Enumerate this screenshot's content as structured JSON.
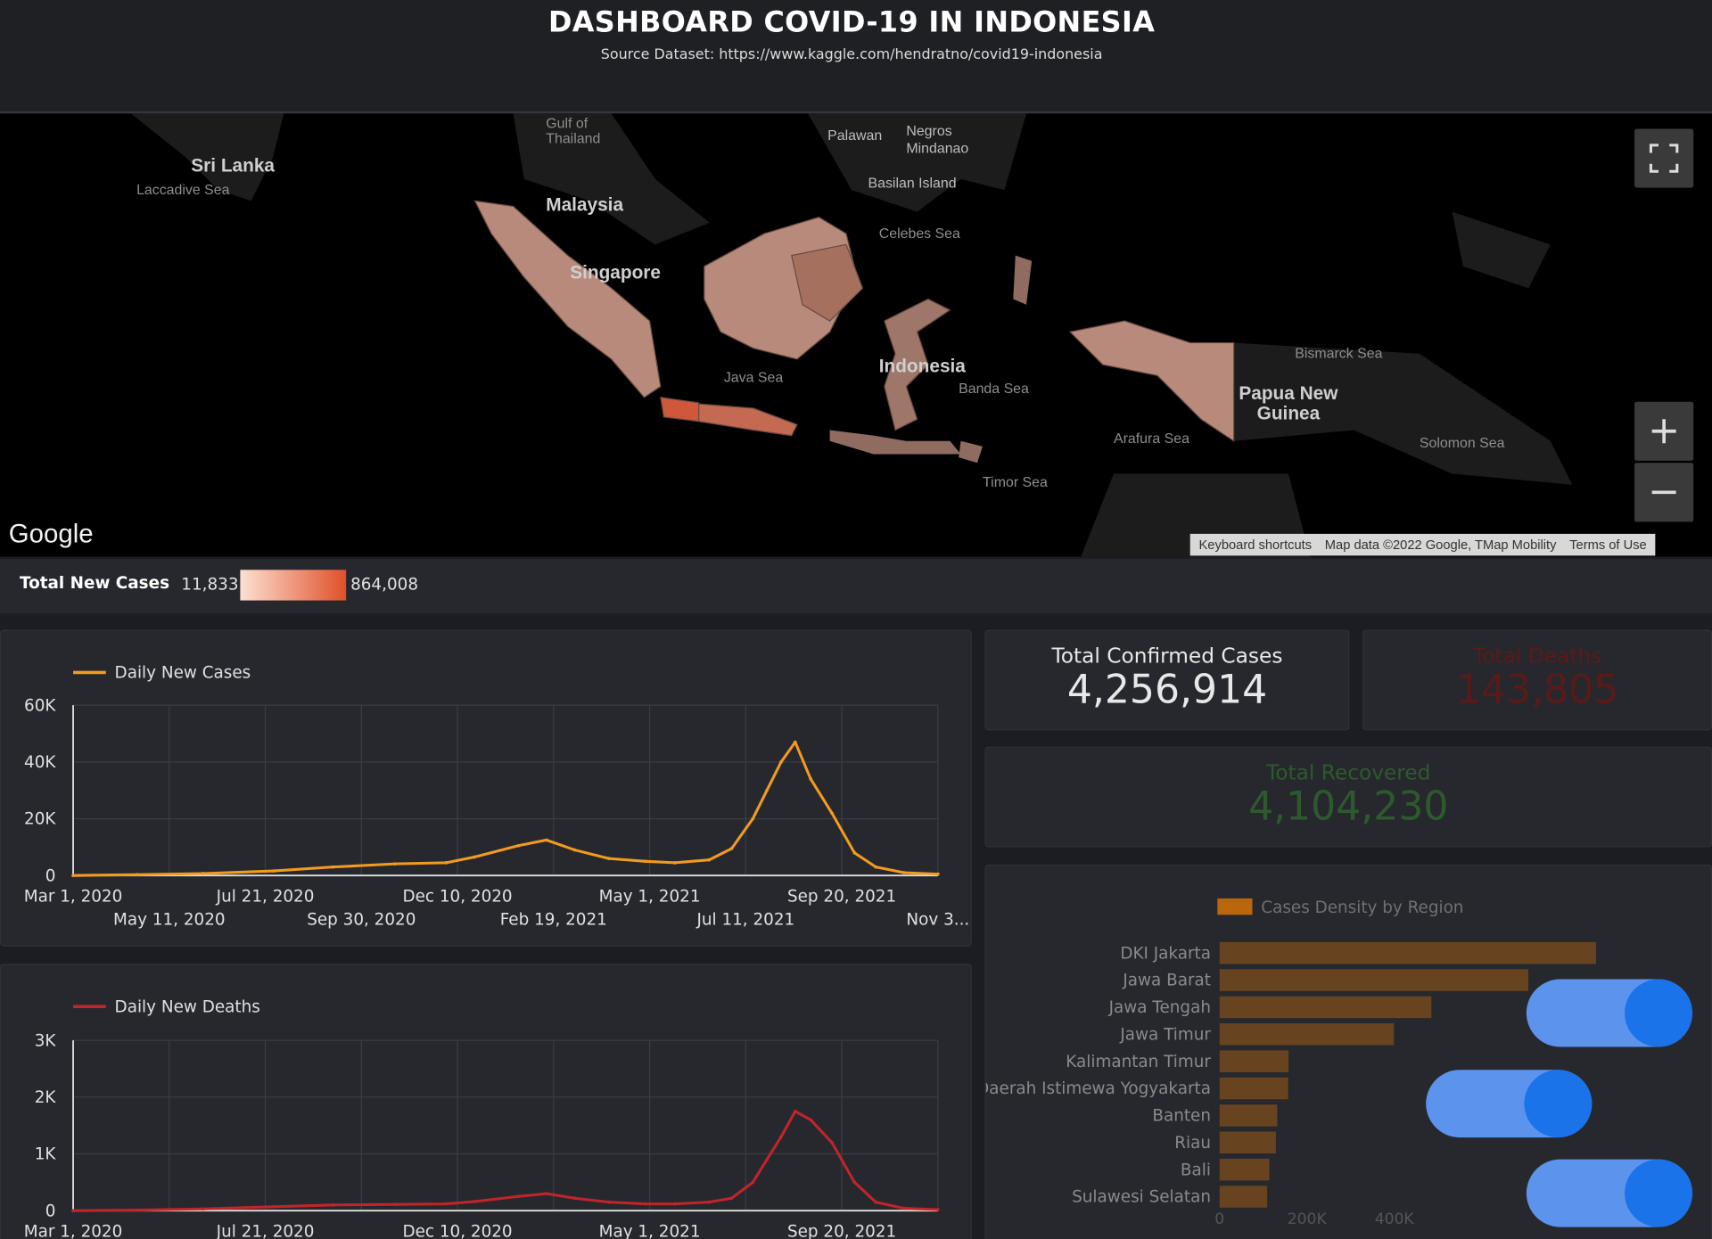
{
  "header": {
    "title": "DASHBOARD COVID-19 IN INDONESIA",
    "subtitle": "Source Dataset: https://www.kaggle.com/hendratno/covid19-indonesia"
  },
  "map": {
    "labels": {
      "sri_lanka": "Sri Lanka",
      "laccadive_sea": "Laccadive Sea",
      "gulf_of_thailand": "Gulf of Thailand",
      "palawan": "Palawan",
      "negros_mindanao": "Negros Mindanao",
      "basilan_island": "Basilan Island",
      "malaysia": "Malaysia",
      "celebes_sea": "Celebes Sea",
      "singapore": "Singapore",
      "java_sea": "Java Sea",
      "indonesia": "Indonesia",
      "banda_sea": "Banda Sea",
      "bismarck_sea": "Bismarck Sea",
      "papua_new_guinea": "Papua New Guinea",
      "arafura_sea": "Arafura Sea",
      "solomon_sea": "Solomon Sea",
      "timor_sea": "Timor Sea"
    },
    "google_logo": "Google",
    "footer": {
      "keyboard_shortcuts": "Keyboard shortcuts",
      "map_data": "Map data ©2022 Google, TMap Mobility",
      "terms": "Terms of Use"
    },
    "icons": {
      "fullscreen": "fullscreen-icon",
      "zoom_in": "plus-icon",
      "zoom_out": "minus-icon"
    },
    "legend": {
      "label": "Total New Cases",
      "min": "11,833",
      "max": "864,008",
      "color_low": "#fde0d2",
      "color_high": "#e0502a"
    }
  },
  "kpis": {
    "confirmed": {
      "label": "Total Confirmed Cases",
      "value": "4,256,914",
      "color": "#e8e8e8"
    },
    "deaths": {
      "label": "Total Deaths",
      "value": "143,805",
      "color": "#5a1a1a"
    },
    "recovered": {
      "label": "Total Recovered",
      "value": "4,104,230",
      "color": "#2d5a2d"
    }
  },
  "chart_data": [
    {
      "type": "line",
      "series": [
        {
          "name": "Daily New Cases",
          "color": "#f29b1d"
        }
      ],
      "x_ticks_top": [
        "Mar 1, 2020",
        "Jul 21, 2020",
        "Dec 10, 2020",
        "May 1, 2021",
        "Sep 20, 2021"
      ],
      "x_ticks_bottom": [
        "May 11, 2020",
        "Sep 30, 2020",
        "Feb 19, 2021",
        "Jul 11, 2021",
        "Nov 3..."
      ],
      "y_ticks": [
        "60K",
        "40K",
        "20K",
        "0"
      ],
      "ylim": [
        0,
        60000
      ],
      "x": [
        "2020-03-01",
        "2020-04-15",
        "2020-06-01",
        "2020-07-21",
        "2020-09-01",
        "2020-10-15",
        "2020-11-20",
        "2020-12-10",
        "2021-01-10",
        "2021-01-30",
        "2021-02-19",
        "2021-03-15",
        "2021-04-10",
        "2021-05-01",
        "2021-05-25",
        "2021-06-10",
        "2021-06-25",
        "2021-07-05",
        "2021-07-15",
        "2021-07-25",
        "2021-08-05",
        "2021-08-20",
        "2021-09-05",
        "2021-09-20",
        "2021-10-10",
        "2021-11-03"
      ],
      "values": [
        0,
        300,
        700,
        1600,
        3000,
        4100,
        4500,
        6500,
        10500,
        12500,
        9000,
        6000,
        5000,
        4500,
        5500,
        9500,
        20000,
        30000,
        40000,
        47000,
        34000,
        22000,
        8000,
        3000,
        1000,
        500
      ]
    },
    {
      "type": "line",
      "series": [
        {
          "name": "Daily New Deaths",
          "color": "#c0252a"
        }
      ],
      "x_ticks_top": [
        "Mar 1, 2020",
        "Jul 21, 2020",
        "Dec 10, 2020",
        "May 1, 2021",
        "Sep 20, 2021"
      ],
      "y_ticks": [
        "3K",
        "2K",
        "1K",
        "0"
      ],
      "ylim": [
        0,
        3000
      ],
      "x": [
        "2020-03-01",
        "2020-04-15",
        "2020-06-01",
        "2020-07-21",
        "2020-09-01",
        "2020-10-15",
        "2020-11-20",
        "2020-12-10",
        "2021-01-10",
        "2021-01-30",
        "2021-02-19",
        "2021-03-15",
        "2021-04-10",
        "2021-05-01",
        "2021-05-25",
        "2021-06-10",
        "2021-06-25",
        "2021-07-05",
        "2021-07-15",
        "2021-07-25",
        "2021-08-05",
        "2021-08-20",
        "2021-09-05",
        "2021-09-20",
        "2021-10-10",
        "2021-11-03"
      ],
      "values": [
        0,
        10,
        30,
        70,
        100,
        110,
        120,
        160,
        250,
        300,
        220,
        150,
        120,
        120,
        150,
        220,
        500,
        900,
        1300,
        1750,
        1600,
        1200,
        500,
        150,
        40,
        20
      ]
    },
    {
      "type": "bar",
      "title": "Cases Density by Region",
      "color": "#b9660d",
      "categories": [
        "DKI Jakarta",
        "Jawa Barat",
        "Jawa Tengah",
        "Jawa Timur",
        "Kalimantan Timur",
        "Daerah Istimewa Yogyakarta",
        "Banten",
        "Riau",
        "Bali",
        "Sulawesi Selatan"
      ],
      "values": [
        862000,
        707000,
        485000,
        399000,
        158000,
        157000,
        132000,
        129000,
        114000,
        109000
      ],
      "x_ticks": [
        "0",
        "200K",
        "400K"
      ]
    }
  ]
}
